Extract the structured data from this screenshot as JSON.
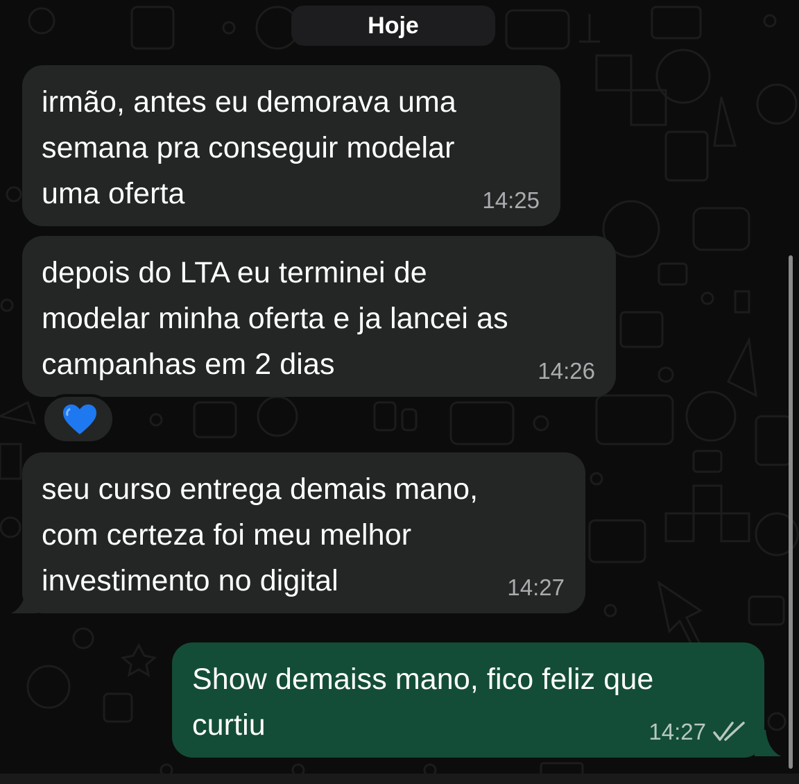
{
  "chat": {
    "date_label": "Hoje",
    "messages": [
      {
        "direction": "incoming",
        "text": "irmão, antes eu demorava uma\nsemana pra conseguir modelar\numa oferta",
        "time": "14:25"
      },
      {
        "direction": "incoming",
        "text": "depois do LTA eu terminei de\nmodelar minha oferta e ja lancei as\ncampanhas em 2 dias",
        "time": "14:26",
        "reaction": "blue-heart"
      },
      {
        "direction": "incoming",
        "text": "seu curso entrega demais mano,\ncom certeza foi meu melhor\ninvestimento no digital",
        "time": "14:27"
      },
      {
        "direction": "outgoing",
        "text": "Show demaiss mano, fico feliz que\ncurtiu",
        "time": "14:27",
        "status_icon": "double-check-read-icon"
      }
    ]
  },
  "colors": {
    "incoming_bubble": "#242626",
    "outgoing_bubble": "#144d37",
    "background": "#0c0c0c",
    "reaction_heart": "#1e78f0"
  }
}
